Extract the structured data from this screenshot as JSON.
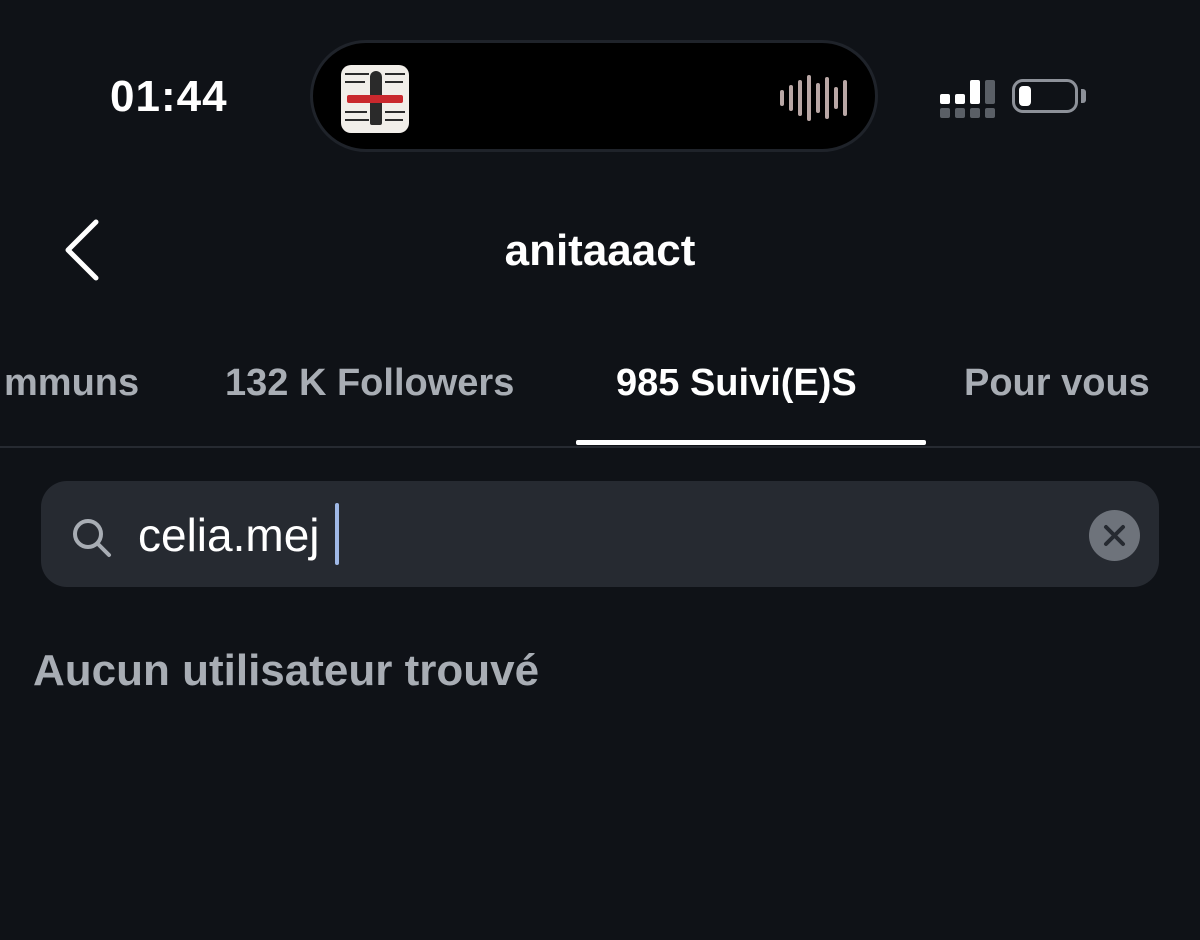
{
  "status_bar": {
    "time": "01:44",
    "now_playing_icon": "album-art-icon",
    "audio_icon": "waveform-icon",
    "signal_icon": "cellular-signal-icon",
    "battery_icon": "battery-icon",
    "battery_level": 0.15
  },
  "header": {
    "back_icon": "chevron-left-icon",
    "title": "anitaaact"
  },
  "tabs": [
    {
      "label": "mmuns",
      "active": false
    },
    {
      "label": "132 K Followers",
      "active": false
    },
    {
      "label": "985 Suivi(E)S",
      "active": true
    },
    {
      "label": "Pour vous",
      "active": false
    }
  ],
  "search": {
    "icon": "search-icon",
    "value": "celia.mej",
    "clear_icon": "close-icon"
  },
  "results": {
    "empty_message": "Aucun utilisateur trouvé"
  },
  "colors": {
    "background": "#0f1217",
    "search_field": "#262a31",
    "muted_text": "#a8adb4",
    "active_text": "#ffffff"
  }
}
